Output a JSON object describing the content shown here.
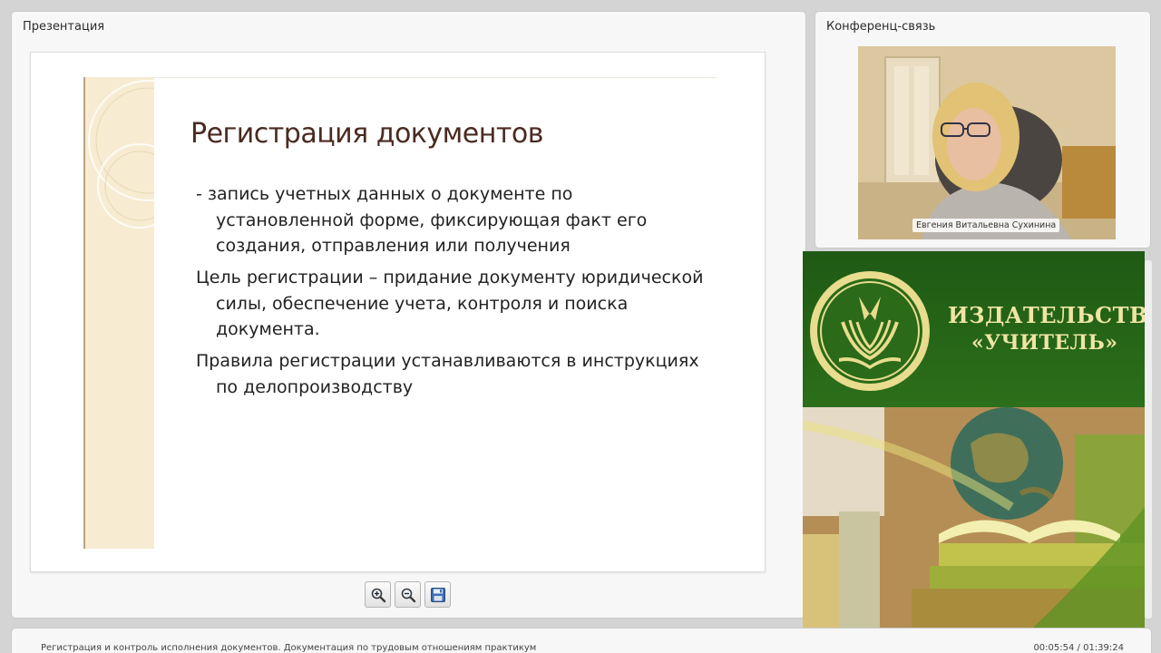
{
  "presentation": {
    "title": "Презентация",
    "slide": {
      "title": "Регистрация документов",
      "paragraphs": [
        "- запись учетных данных о документе по установленной форме, фиксирующая факт его создания, отправления или получения",
        "Цель регистрации – придание документу юридической силы, обеспечение учета, контроля и поиска документа.",
        "Правила регистрации  устанавливаются в инструкциях по делопроизводству"
      ]
    },
    "tools": [
      {
        "icon": "zoom-in-icon"
      },
      {
        "icon": "zoom-out-icon"
      },
      {
        "icon": "save-icon"
      }
    ]
  },
  "conference": {
    "title": "Конференц-связь",
    "speaker_name": "Евгения Витальевна Сухинина"
  },
  "publisher": {
    "line1": "ИЗДАТЕЛЬСТВО",
    "line2": "«УЧИТЕЛЬ»",
    "colors": {
      "green": "#2c6f1a",
      "gold": "#efe5a4"
    }
  },
  "footer": {
    "lecture_title": "Регистрация и контроль исполнения документов. Документация по трудовым отношениям практикум",
    "time": "00:05:54 / 01:39:24"
  }
}
